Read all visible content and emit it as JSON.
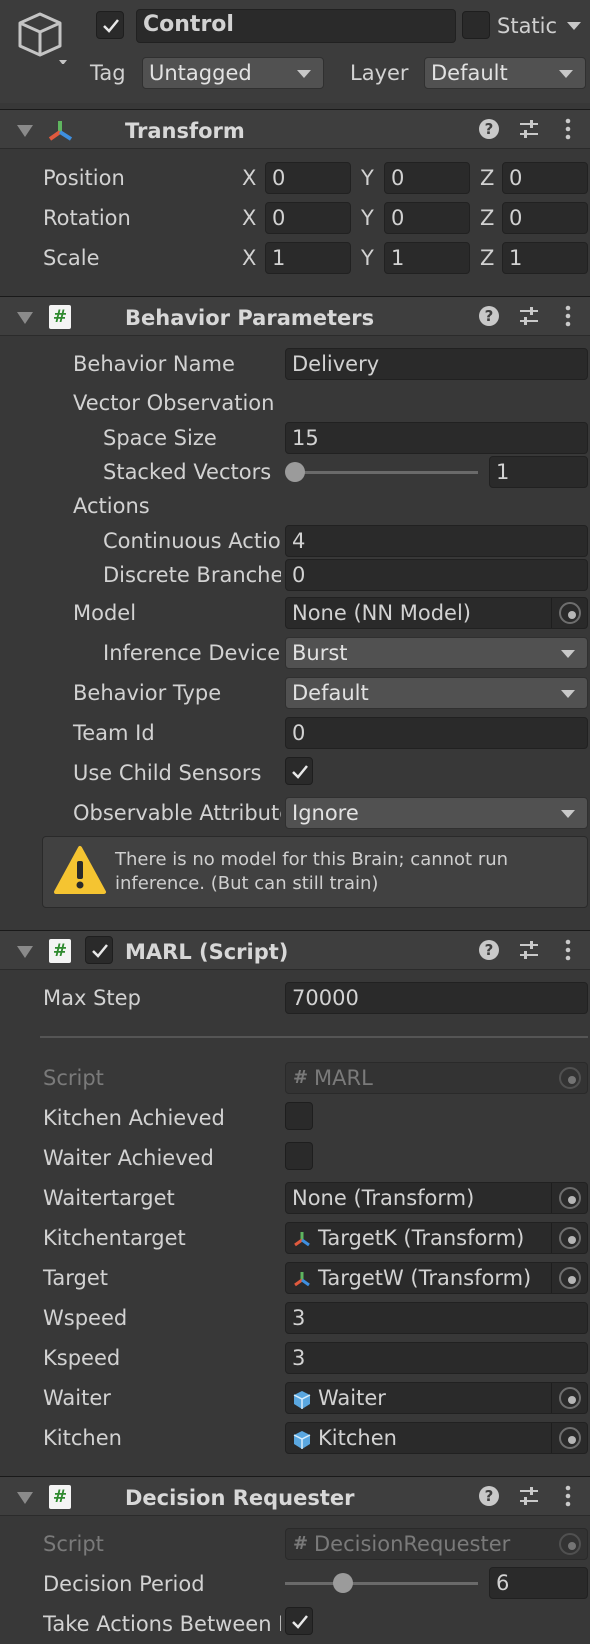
{
  "header": {
    "enabled": true,
    "object_name": "Control",
    "static_label": "Static",
    "static_checked": false,
    "tag_label": "Tag",
    "tag_value": "Untagged",
    "layer_label": "Layer",
    "layer_value": "Default"
  },
  "transform": {
    "title": "Transform",
    "rows": [
      {
        "label": "Position",
        "x_label": "X",
        "x": "0",
        "y_label": "Y",
        "y": "0",
        "z_label": "Z",
        "z": "0"
      },
      {
        "label": "Rotation",
        "x_label": "X",
        "x": "0",
        "y_label": "Y",
        "y": "0",
        "z_label": "Z",
        "z": "0"
      },
      {
        "label": "Scale",
        "x_label": "X",
        "x": "1",
        "y_label": "Y",
        "y": "1",
        "z_label": "Z",
        "z": "1"
      }
    ]
  },
  "behavior": {
    "title": "Behavior Parameters",
    "behavior_name_label": "Behavior Name",
    "behavior_name": "Delivery",
    "vector_obs_label": "Vector Observation",
    "space_size_label": "Space Size",
    "space_size": "15",
    "stacked_label": "Stacked Vectors",
    "stacked_value": "1",
    "stacked_fraction": 0.0,
    "actions_label": "Actions",
    "continuous_label": "Continuous Actions",
    "continuous_value": "4",
    "discrete_label": "Discrete Branches",
    "discrete_value": "0",
    "model_label": "Model",
    "model_value": "None (NN Model)",
    "inference_label": "Inference Device",
    "inference_value": "Burst",
    "behavior_type_label": "Behavior Type",
    "behavior_type_value": "Default",
    "team_id_label": "Team Id",
    "team_id": "0",
    "use_child_label": "Use Child Sensors",
    "use_child_checked": true,
    "observable_label": "Observable Attributes",
    "observable_value": "Ignore",
    "warning_line1": "There is no model for this Brain; cannot run",
    "warning_line2": "inference. (But can still train)"
  },
  "marl": {
    "title": "MARL (Script)",
    "enabled": true,
    "max_step_label": "Max Step",
    "max_step": "70000",
    "script_label": "Script",
    "script_value": "MARL",
    "kitchen_achieved_label": "Kitchen Achieved",
    "kitchen_achieved": false,
    "waiter_achieved_label": "Waiter Achieved",
    "waiter_achieved": false,
    "waitertarget_label": "Waitertarget",
    "waitertarget_value": "None (Transform)",
    "kitchentarget_label": "Kitchentarget",
    "kitchentarget_value": "TargetK (Transform)",
    "target_label": "Target",
    "target_value": "TargetW (Transform)",
    "wspeed_label": "Wspeed",
    "wspeed": "3",
    "kspeed_label": "Kspeed",
    "kspeed": "3",
    "waiter_label": "Waiter",
    "waiter_value": "Waiter",
    "kitchen_label": "Kitchen",
    "kitchen_value": "Kitchen"
  },
  "decision": {
    "title": "Decision Requester",
    "script_label": "Script",
    "script_value": "DecisionRequester",
    "period_label": "Decision Period",
    "period_value": "6",
    "period_fraction": 0.28,
    "take_actions_label": "Take Actions Between Decisions",
    "take_actions_checked": true
  },
  "icons": {
    "help": "help-icon",
    "presets": "presets-icon",
    "menu": "kebab-menu-icon",
    "gameobject": "cube-icon",
    "transform": "transform-axes-icon",
    "script": "script-hash-icon",
    "warning": "warning-icon"
  },
  "colors": {
    "background": "#383838",
    "field": "#2a2a2a",
    "header": "#3e3e3e",
    "warning": "#f5c431",
    "script_green": "#2f8a2f",
    "prefab_blue": "#5aa7e0"
  }
}
